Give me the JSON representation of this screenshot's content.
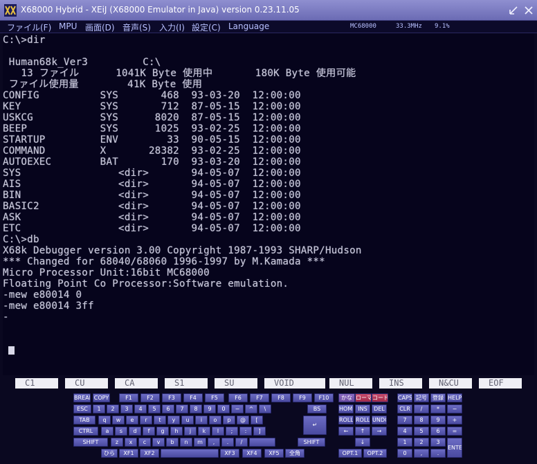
{
  "window": {
    "title": "X68000 Hybrid - XEiJ (X68000 Emulator in Java) version 0.23.11.05"
  },
  "menu": {
    "items": [
      "ファイル(F)",
      "MPU",
      "画面(D)",
      "音声(S)",
      "入力(I)",
      "設定(C)",
      "Language"
    ]
  },
  "status": {
    "cpu": "MC68000",
    "clock": "33.3MHz",
    "load": "9.1%"
  },
  "terminal": {
    "lines": [
      "C:\\>dir",
      "",
      " Human68k_Ver3         C:\\",
      "   13 ファイル      1041K Byte 使用中       180K Byte 使用可能",
      " ファイル使用量        41K Byte 使用",
      "CONFIG          SYS       468  93-03-20  12:00:00",
      "KEY             SYS       712  87-05-15  12:00:00",
      "USKCG           SYS      8020  87-05-15  12:00:00",
      "BEEP            SYS      1025  93-02-25  12:00:00",
      "STARTUP         ENV        33  90-05-15  12:00:00",
      "COMMAND         X       28382  93-02-25  12:00:00",
      "AUTOEXEC        BAT       170  93-03-20  12:00:00",
      "SYS                <dir>       94-05-07  12:00:00",
      "AIS                <dir>       94-05-07  12:00:00",
      "BIN                <dir>       94-05-07  12:00:00",
      "BASIC2             <dir>       94-05-07  12:00:00",
      "ASK                <dir>       94-05-07  12:00:00",
      "ETC                <dir>       94-05-07  12:00:00",
      "C:\\>db",
      "X68k Debugger version 3.00 Copyright 1987-1993 SHARP/Hudson",
      "*** Changed for 68040/68060 1996-1997 by M.Kamada ***",
      "Micro Processor Unit:16bit MC68000",
      "Floating Point Co Processor:Software emulation.",
      "-mew e80014 0",
      "-mew e80014 3ff",
      "-"
    ]
  },
  "function_keys": [
    "C1",
    "CU",
    "CA",
    "S1",
    "SU",
    "VOID",
    "NUL",
    "INS",
    "N&CU",
    "EOF"
  ],
  "keyboard": {
    "row0": [
      "BREAK",
      "COPY",
      "F1",
      "F2",
      "F3",
      "F4",
      "F5",
      "F6",
      "F7",
      "F8",
      "F9",
      "F10",
      "かな",
      "ローマ",
      "コード",
      "CAPS",
      "記号",
      "登録",
      "HELP"
    ],
    "row1": [
      "ESC",
      "1",
      "2",
      "3",
      "4",
      "5",
      "6",
      "7",
      "8",
      "9",
      "0",
      "−",
      "^",
      "\\",
      "BS",
      "HOME",
      "INS",
      "DEL",
      "CLR",
      "/",
      "*",
      "−"
    ],
    "row2": [
      "TAB",
      "q",
      "w",
      "e",
      "r",
      "t",
      "y",
      "u",
      "i",
      "o",
      "p",
      "@",
      "[",
      "↵",
      "ROLL UP",
      "ROLL DOWN",
      "UNDO",
      "7",
      "8",
      "9",
      "+"
    ],
    "row3": [
      "CTRL",
      "a",
      "s",
      "d",
      "f",
      "g",
      "h",
      "j",
      "k",
      "l",
      ";",
      ":",
      "]",
      "←",
      "↑",
      "→",
      "4",
      "5",
      "6",
      "="
    ],
    "row4": [
      "SHIFT",
      "z",
      "x",
      "c",
      "v",
      "b",
      "n",
      "m",
      ",",
      ".",
      "/",
      "",
      "SHIFT",
      "↓",
      "1",
      "2",
      "3"
    ],
    "row5": [
      "ひら",
      "XF1",
      "XF2",
      "",
      "XF3",
      "XF4",
      "XF5",
      "全角",
      "OPT.1",
      "OPT.2",
      "0",
      ",",
      ".",
      "ENTER"
    ]
  },
  "colors": {
    "titlebar": "#7c7cc4",
    "menu_text": "#b8c0ff",
    "screen_bg": "#06041c",
    "terminal_text": "#c8c8d8",
    "key": "#5a5ab0",
    "function_key": "#efeff5"
  }
}
